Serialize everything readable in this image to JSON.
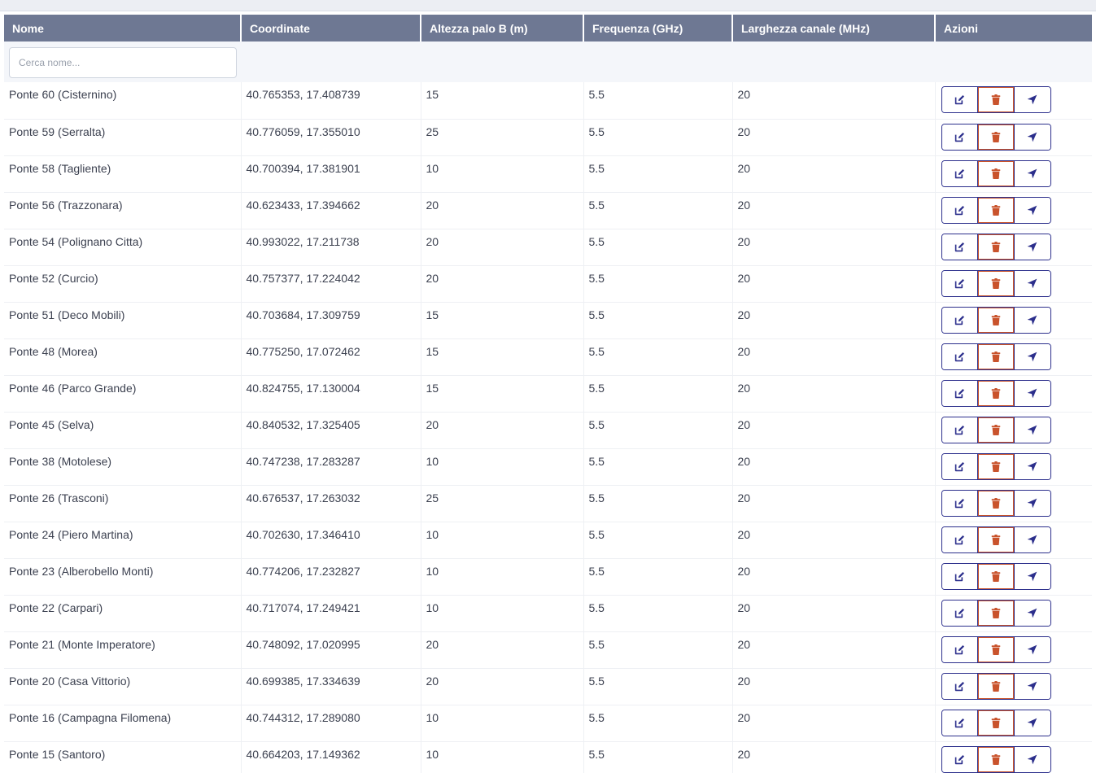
{
  "colors": {
    "header_bg": "#6e7893",
    "accent_blue": "#2c2f8c",
    "danger": "#c9532c"
  },
  "table": {
    "headers": [
      "Nome",
      "Coordinate",
      "Altezza palo B (m)",
      "Frequenza (GHz)",
      "Larghezza canale (MHz)",
      "Azioni"
    ],
    "search_placeholder": "Cerca nome...",
    "search_value": "",
    "action_icons": [
      "edit-icon",
      "trash-icon",
      "navigate-icon"
    ],
    "rows": [
      {
        "nome": "Ponte 60 (Cisternino)",
        "coordinate": "40.765353, 17.408739",
        "altezza": "15",
        "frequenza": "5.5",
        "larghezza": "20"
      },
      {
        "nome": "Ponte 59 (Serralta)",
        "coordinate": "40.776059, 17.355010",
        "altezza": "25",
        "frequenza": "5.5",
        "larghezza": "20"
      },
      {
        "nome": "Ponte 58 (Tagliente)",
        "coordinate": "40.700394, 17.381901",
        "altezza": "10",
        "frequenza": "5.5",
        "larghezza": "20"
      },
      {
        "nome": "Ponte 56 (Trazzonara)",
        "coordinate": "40.623433, 17.394662",
        "altezza": "20",
        "frequenza": "5.5",
        "larghezza": "20"
      },
      {
        "nome": "Ponte 54 (Polignano Citta)",
        "coordinate": "40.993022, 17.211738",
        "altezza": "20",
        "frequenza": "5.5",
        "larghezza": "20"
      },
      {
        "nome": "Ponte 52 (Curcio)",
        "coordinate": "40.757377, 17.224042",
        "altezza": "20",
        "frequenza": "5.5",
        "larghezza": "20"
      },
      {
        "nome": "Ponte 51 (Deco Mobili)",
        "coordinate": "40.703684, 17.309759",
        "altezza": "15",
        "frequenza": "5.5",
        "larghezza": "20"
      },
      {
        "nome": "Ponte 48 (Morea)",
        "coordinate": "40.775250, 17.072462",
        "altezza": "15",
        "frequenza": "5.5",
        "larghezza": "20"
      },
      {
        "nome": "Ponte 46 (Parco Grande)",
        "coordinate": "40.824755, 17.130004",
        "altezza": "15",
        "frequenza": "5.5",
        "larghezza": "20"
      },
      {
        "nome": "Ponte 45 (Selva)",
        "coordinate": "40.840532, 17.325405",
        "altezza": "20",
        "frequenza": "5.5",
        "larghezza": "20"
      },
      {
        "nome": "Ponte 38 (Motolese)",
        "coordinate": "40.747238, 17.283287",
        "altezza": "10",
        "frequenza": "5.5",
        "larghezza": "20"
      },
      {
        "nome": "Ponte 26 (Trasconi)",
        "coordinate": "40.676537, 17.263032",
        "altezza": "25",
        "frequenza": "5.5",
        "larghezza": "20"
      },
      {
        "nome": "Ponte 24 (Piero Martina)",
        "coordinate": "40.702630, 17.346410",
        "altezza": "10",
        "frequenza": "5.5",
        "larghezza": "20"
      },
      {
        "nome": "Ponte 23 (Alberobello Monti)",
        "coordinate": "40.774206, 17.232827",
        "altezza": "10",
        "frequenza": "5.5",
        "larghezza": "20"
      },
      {
        "nome": "Ponte 22 (Carpari)",
        "coordinate": "40.717074, 17.249421",
        "altezza": "10",
        "frequenza": "5.5",
        "larghezza": "20"
      },
      {
        "nome": "Ponte 21 (Monte Imperatore)",
        "coordinate": "40.748092, 17.020995",
        "altezza": "20",
        "frequenza": "5.5",
        "larghezza": "20"
      },
      {
        "nome": "Ponte 20 (Casa Vittorio)",
        "coordinate": "40.699385, 17.334639",
        "altezza": "20",
        "frequenza": "5.5",
        "larghezza": "20"
      },
      {
        "nome": "Ponte 16 (Campagna Filomena)",
        "coordinate": "40.744312, 17.289080",
        "altezza": "10",
        "frequenza": "5.5",
        "larghezza": "20"
      },
      {
        "nome": "Ponte 15 (Santoro)",
        "coordinate": "40.664203, 17.149362",
        "altezza": "10",
        "frequenza": "5.5",
        "larghezza": "20"
      }
    ]
  }
}
